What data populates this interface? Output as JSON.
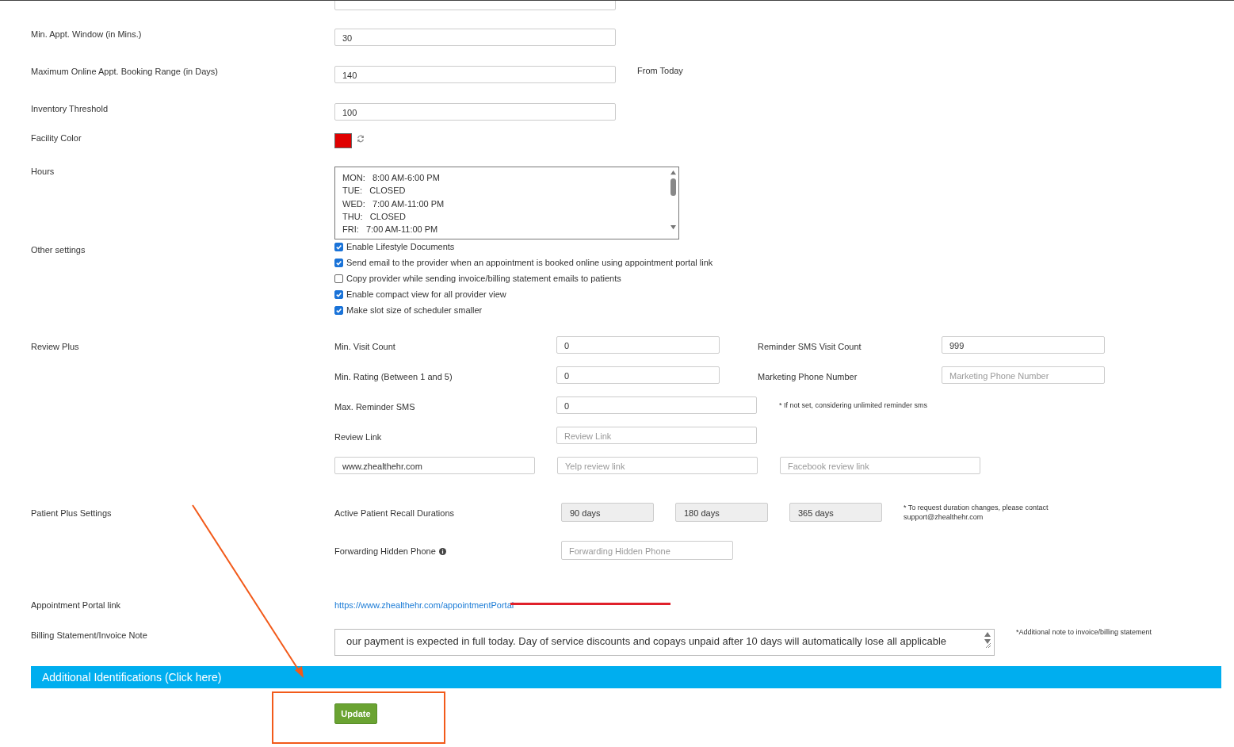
{
  "fields": [
    {
      "label": "Min. Appt. Window (in Mins.)",
      "value": "30"
    },
    {
      "label": "Maximum Online Appt. Booking Range (in Days)",
      "value": "140",
      "note": "From Today"
    },
    {
      "label": "Inventory Threshold",
      "value": "100"
    }
  ],
  "facility_color": {
    "label": "Facility Color",
    "color": "#e00000"
  },
  "hours": {
    "label": "Hours",
    "lines": [
      "MON:   8:00 AM-6:00 PM",
      "TUE:   CLOSED",
      "WED:   7:00 AM-11:00 PM",
      "THU:   CLOSED",
      "FRI:   7:00 AM-11:00 PM"
    ]
  },
  "other_settings": {
    "label": "Other settings",
    "options": [
      {
        "label": "Enable Lifestyle Documents",
        "checked": true
      },
      {
        "label": "Send email to the provider when an appointment is booked online using appointment portal link",
        "checked": true
      },
      {
        "label": "Copy provider while sending invoice/billing statement emails to patients",
        "checked": false
      },
      {
        "label": "Enable compact view for all provider view",
        "checked": true
      },
      {
        "label": "Make slot size of scheduler smaller",
        "checked": true
      }
    ]
  },
  "review_plus": {
    "label": "Review Plus",
    "min_visit_count": {
      "label": "Min. Visit Count",
      "value": "0"
    },
    "reminder_sms_visit_count": {
      "label": "Reminder SMS Visit Count",
      "value": "999"
    },
    "min_rating": {
      "label": "Min. Rating (Between 1 and 5)",
      "value": "0"
    },
    "marketing_phone": {
      "label": "Marketing Phone Number",
      "placeholder": "Marketing Phone Number"
    },
    "max_reminder_sms": {
      "label": "Max. Reminder SMS",
      "value": "0",
      "note": "* If not set, considering unlimited reminder sms"
    },
    "review_link": {
      "label": "Review Link",
      "placeholder": "Review Link"
    },
    "website": {
      "value": "www.zhealthehr.com"
    },
    "yelp": {
      "placeholder": "Yelp review link"
    },
    "facebook": {
      "placeholder": "Facebook review link"
    }
  },
  "patient_plus": {
    "label": "Patient Plus Settings",
    "recall": {
      "label": "Active Patient Recall Durations",
      "durations": [
        "90 days",
        "180 days",
        "365 days"
      ],
      "note": "* To request duration changes, please contact support@zhealthehr.com"
    },
    "forwarding": {
      "label": "Forwarding Hidden Phone",
      "placeholder": "Forwarding Hidden Phone"
    }
  },
  "portal": {
    "label": "Appointment Portal link",
    "link": "https://www.zhealthehr.com/appointmentPortal"
  },
  "billing": {
    "label": "Billing Statement/Invoice Note",
    "value": "our payment is expected in full today. Day of service discounts and copays unpaid after 10 days will automatically lose all applicable",
    "note": "*Additional note to invoice/billing statement"
  },
  "section_bar": "Additional Identifications (Click here)",
  "update_button": "Update"
}
